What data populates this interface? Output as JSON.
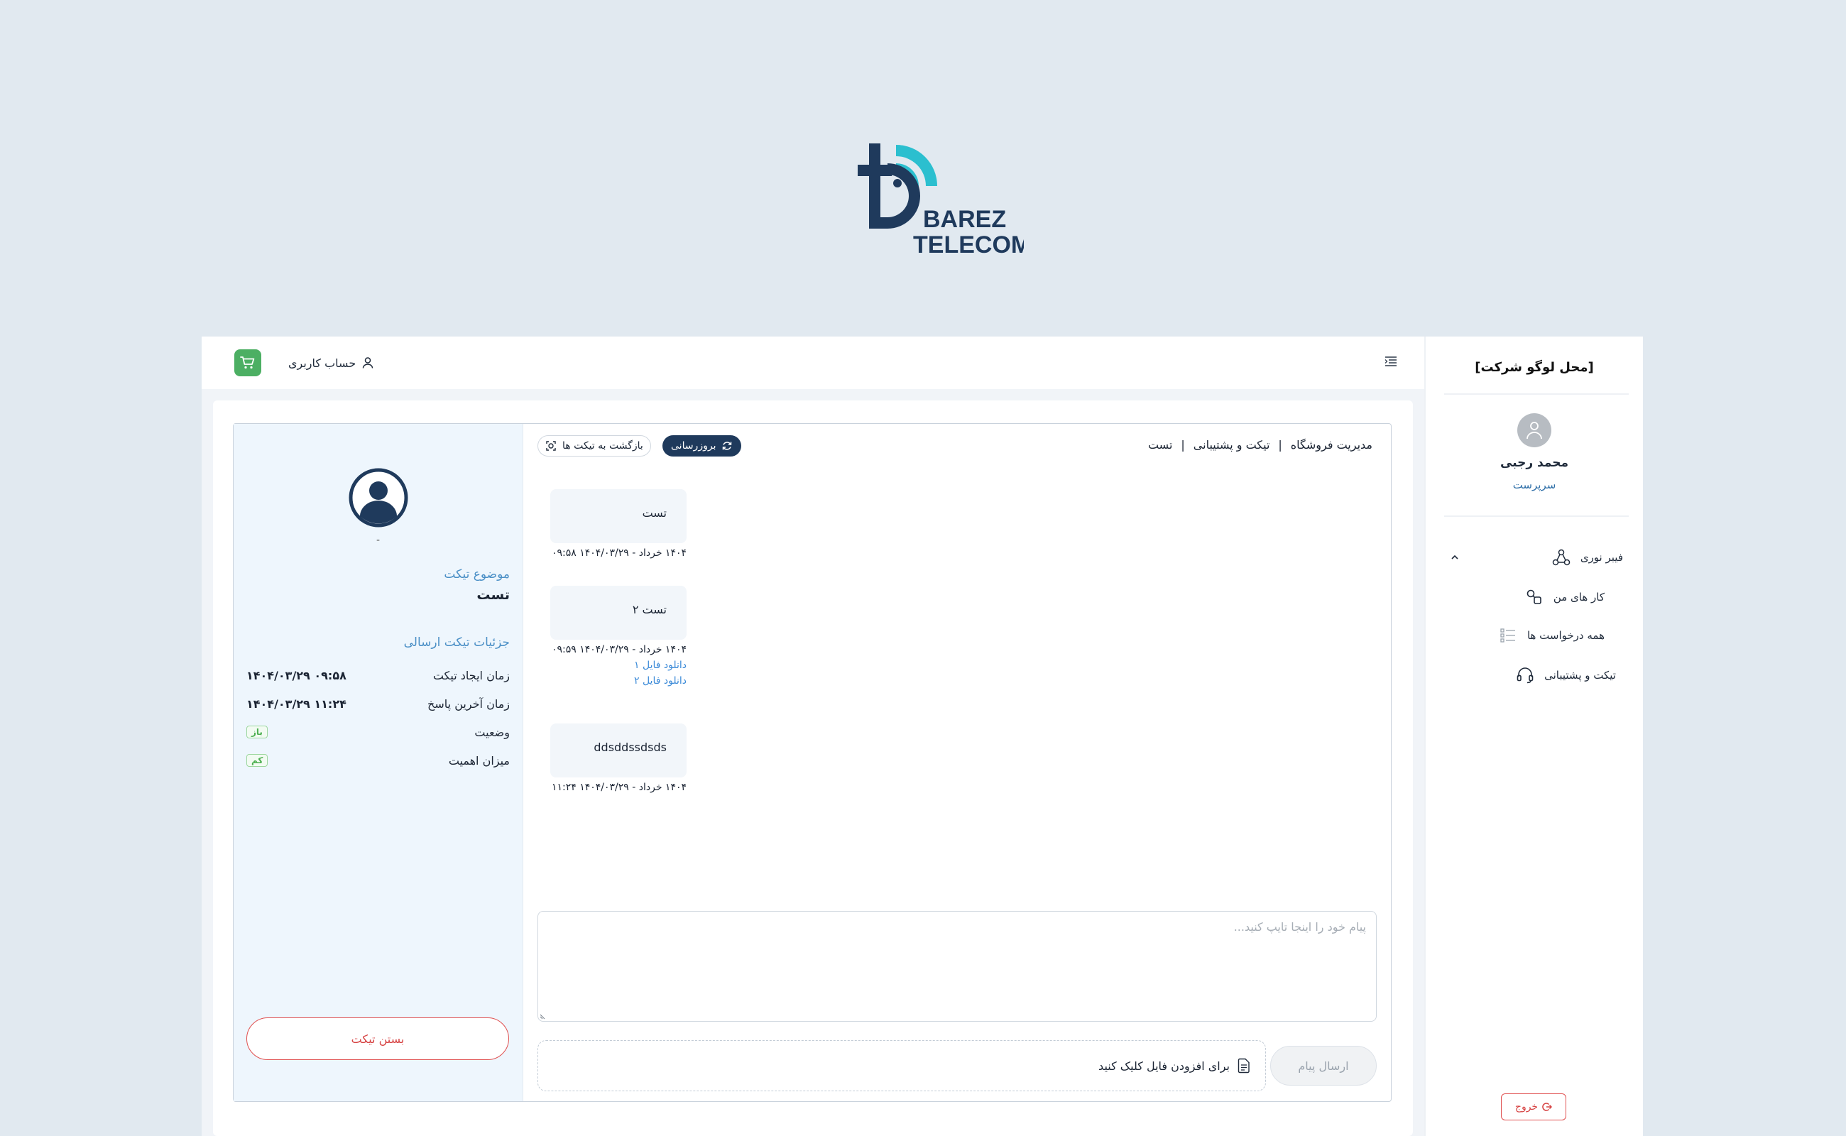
{
  "brand": {
    "line1": "BAREZ",
    "line2": "TELECOM",
    "color_dark": "#1f3a5c",
    "color_accent": "#2bbfcf"
  },
  "sidebar": {
    "company_logo": "[محل لوگو شرکت]",
    "user_name": "محمد رجبی",
    "user_role": "سرپرست",
    "menu": {
      "fiber": "فیبر نوری",
      "my_tasks": "کار های من",
      "all_requests": "همه درخواست ها",
      "tickets": "تیکت و پشتیبانی"
    },
    "logout": "خروج"
  },
  "topbar": {
    "account": "حساب کاربری"
  },
  "breadcrumb": {
    "store": "مدیریت فروشگاه",
    "sep": "|",
    "tickets": "تیکت و پشتیبانی",
    "current": "تست"
  },
  "actions": {
    "refresh": "بروزرسانی",
    "back": "بازگشت به تیکت ها"
  },
  "ticket": {
    "dot": "-",
    "subject_label": "موضوع تیکت",
    "subject": "تست",
    "details_title": "جزئیات تیکت ارسالی",
    "created_label": "زمان ایجاد تیکت",
    "created_value": "۱۴۰۴/۰۳/۲۹ ۰۹:۵۸",
    "last_reply_label": "زمان آخرین پاسخ",
    "last_reply_value": "۱۴۰۴/۰۳/۲۹ ۱۱:۲۴",
    "status_label": "وضعیت",
    "status_value": "باز",
    "priority_label": "میزان اهمیت",
    "priority_value": "کم",
    "close_button": "بستن تیکت",
    "status_color": "#4caf50"
  },
  "messages": [
    {
      "text": "تست",
      "time": "۱۴۰۴ خرداد - ۱۴۰۴/۰۳/۲۹ ۰۹:۵۸"
    },
    {
      "text": "تست ۲",
      "time": "۱۴۰۴ خرداد - ۱۴۰۴/۰۳/۲۹ ۰۹:۵۹",
      "links": [
        "دانلود فایل ۱",
        "دانلود فایل ۲"
      ]
    },
    {
      "text": "ddsddssdsds",
      "time": "۱۴۰۴ خرداد - ۱۴۰۴/۰۳/۲۹ ۱۱:۲۴"
    }
  ],
  "composer": {
    "placeholder": "پیام خود را اینجا تایپ کنید...",
    "attach": "برای افزودن فایل کلیک کنید",
    "send": "ارسال پیام"
  }
}
